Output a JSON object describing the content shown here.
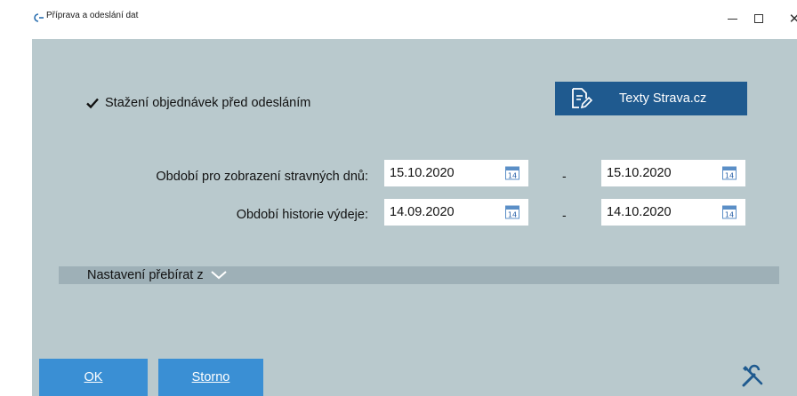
{
  "window": {
    "title": "Příprava a odeslání dat",
    "close_glyph": "✕"
  },
  "form": {
    "download_orders": {
      "label": "Stažení objednávek před odesláním",
      "checked": true
    },
    "texty_button_label": "Texty Strava.cz",
    "display_period": {
      "label": "Období pro zobrazení stravných dnů:",
      "from": "15.10.2020",
      "to": "15.10.2020"
    },
    "history_period": {
      "label": "Období historie výdeje:",
      "from": "14.09.2020",
      "to": "14.10.2020"
    },
    "range_separator": "-",
    "calendar_day": "14",
    "settings_section_label": "Nastavení přebírat z"
  },
  "footer": {
    "ok_label": "OK",
    "cancel_label": "Storno"
  },
  "colors": {
    "client_bg": "#b9c9cd",
    "section_bar": "#9eb0b7",
    "accent_dark": "#1f5a8f",
    "accent_button": "#3a8fd4"
  },
  "icons": [
    "app-icon",
    "check-icon",
    "document-edit-icon",
    "calendar-icon",
    "chevron-down-icon",
    "tools-icon"
  ]
}
